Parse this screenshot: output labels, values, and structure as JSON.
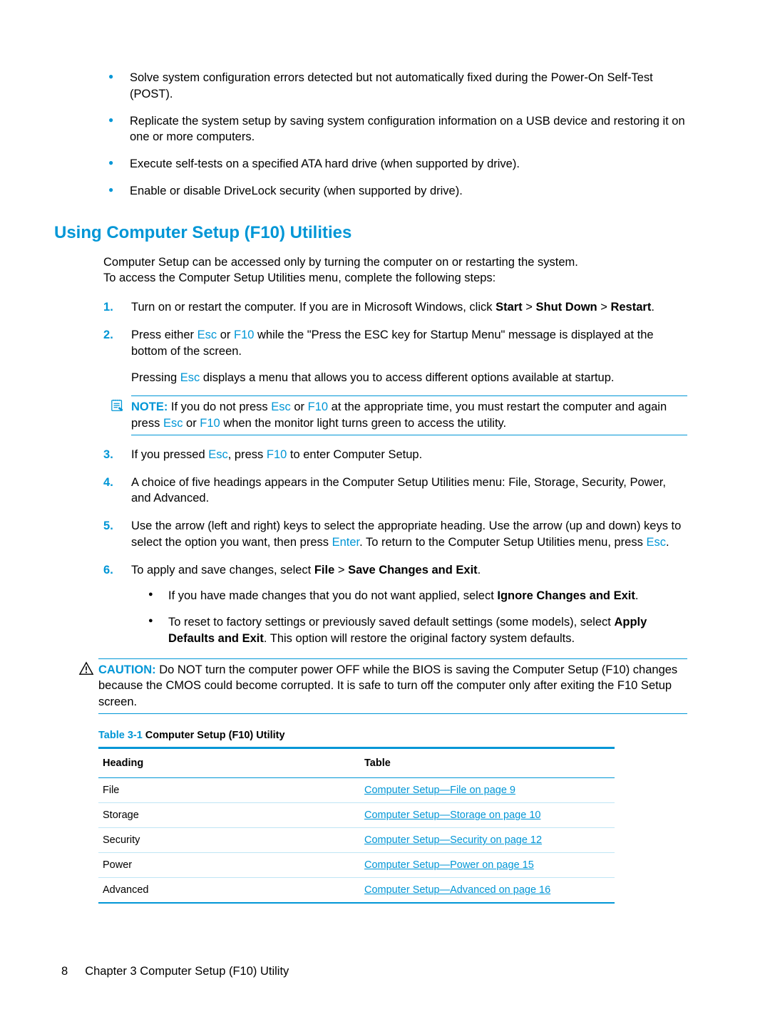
{
  "top_bullets": [
    "Solve system configuration errors detected but not automatically fixed during the Power-On Self-Test (POST).",
    "Replicate the system setup by saving system configuration information on a USB device and restoring it on one or more computers.",
    "Execute self-tests on a specified ATA hard drive (when supported by drive).",
    "Enable or disable DriveLock security (when supported by drive)."
  ],
  "section_heading": "Using Computer Setup (F10) Utilities",
  "intro_line1": "Computer Setup can be accessed only by turning the computer on or restarting the system.",
  "intro_line2": "To access the Computer Setup Utilities menu, complete the following steps:",
  "step1": {
    "pre": "Turn on or restart the computer. If you are in Microsoft Windows, click ",
    "b1": "Start",
    "sep": " > ",
    "b2": "Shut Down",
    "b3": "Restart",
    "post": "."
  },
  "step2": {
    "p1_a": "Press either ",
    "esc": "Esc",
    "or": " or ",
    "f10": "F10",
    "p1_b": " while the \"Press the ESC key for Startup Menu\" message is displayed at the bottom of the screen.",
    "p2_a": "Pressing ",
    "p2_b": " displays a menu that allows you to access different options available at startup.",
    "note_label": "NOTE:",
    "note_a": "   If you do not press ",
    "note_b": " at the appropriate time, you must restart the computer and again press ",
    "note_c": " when the monitor light turns green to access the utility."
  },
  "step3": {
    "a": "If you pressed ",
    "b": ", press ",
    "c": " to enter Computer Setup.",
    "esc": "Esc",
    "f10": "F10"
  },
  "step4": "A choice of five headings appears in the Computer Setup Utilities menu: File, Storage, Security, Power, and Advanced.",
  "step5": {
    "a": "Use the arrow (left and right) keys to select the appropriate heading. Use the arrow (up and down) keys to select the option you want, then press ",
    "enter": "Enter",
    "b": ". To return to the Computer Setup Utilities menu, press ",
    "esc": "Esc",
    "c": "."
  },
  "step6": {
    "lead_a": "To apply and save changes, select ",
    "file": "File",
    "sep": " > ",
    "save": "Save Changes and Exit",
    "lead_b": ".",
    "sub1_a": "If you have made changes that you do not want applied, select ",
    "sub1_b": "Ignore Changes and Exit",
    "sub1_c": ".",
    "sub2_a": "To reset to factory settings or previously saved default settings (some models), select ",
    "sub2_b": "Apply Defaults and Exit",
    "sub2_c": ". This option will restore the original factory system defaults."
  },
  "caution": {
    "label": "CAUTION:",
    "text": "   Do NOT turn the computer power OFF while the BIOS is saving the Computer Setup (F10) changes because the CMOS could become corrupted. It is safe to turn off the computer only after exiting the F10 Setup screen."
  },
  "table": {
    "caption_num": "Table 3-1",
    "caption_title": "  Computer Setup (F10) Utility",
    "head1": "Heading",
    "head2": "Table",
    "rows": [
      {
        "h": "File",
        "link": "Computer Setup—File on page 9"
      },
      {
        "h": "Storage",
        "link": "Computer Setup—Storage on page 10"
      },
      {
        "h": "Security",
        "link": "Computer Setup—Security on page 12"
      },
      {
        "h": "Power",
        "link": "Computer Setup—Power on page 15"
      },
      {
        "h": "Advanced",
        "link": "Computer Setup—Advanced on page 16"
      }
    ]
  },
  "footer": {
    "page": "8",
    "chapter": "Chapter 3   Computer Setup (F10) Utility"
  }
}
